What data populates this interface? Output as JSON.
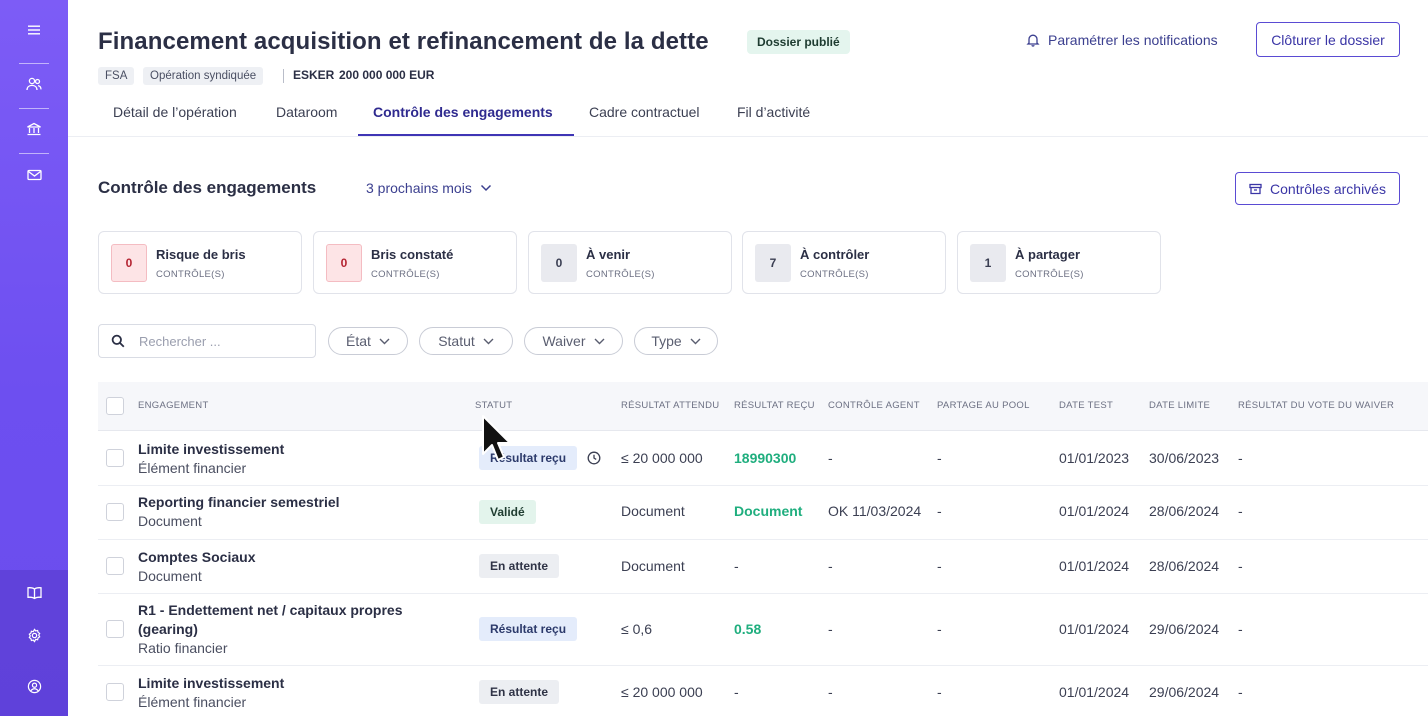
{
  "sidebar": {
    "icons": [
      "menu-icon",
      "users-icon",
      "bank-icon",
      "mail-icon",
      "book-icon",
      "settings-icon",
      "user-circle-icon"
    ]
  },
  "header": {
    "title": "Financement acquisition et refinancement de la dette",
    "status_badge": "Dossier publié",
    "tags": [
      "FSA",
      "Opération syndiquée"
    ],
    "company": "ESKER",
    "amount": "200 000 000 EUR",
    "notifications_label": "Paramétrer les notifications",
    "close_button": "Clôturer le dossier"
  },
  "tabs": [
    {
      "label": "Détail de l’opération"
    },
    {
      "label": "Dataroom"
    },
    {
      "label": "Contrôle des engagements",
      "active": true
    },
    {
      "label": "Cadre contractuel"
    },
    {
      "label": "Fil d’activité"
    }
  ],
  "section": {
    "title": "Contrôle des engagements",
    "period": "3 prochains mois",
    "archived_button": "Contrôles archivés"
  },
  "cards": [
    {
      "count": "0",
      "label": "Risque de bris",
      "sub": "CONTRÔLE(S)",
      "tone": "risk"
    },
    {
      "count": "0",
      "label": "Bris constaté",
      "sub": "CONTRÔLE(S)",
      "tone": "risk"
    },
    {
      "count": "0",
      "label": "À venir",
      "sub": "CONTRÔLE(S)",
      "tone": "neutral"
    },
    {
      "count": "7",
      "label": "À contrôler",
      "sub": "CONTRÔLE(S)",
      "tone": "neutral"
    },
    {
      "count": "1",
      "label": "À partager",
      "sub": "CONTRÔLE(S)",
      "tone": "neutral"
    }
  ],
  "filters": {
    "search_placeholder": "Rechercher ...",
    "search_value": "",
    "dropdowns": [
      "État",
      "Statut",
      "Waiver",
      "Type"
    ]
  },
  "table": {
    "columns": [
      "ENGAGEMENT",
      "STATUT",
      "RÉSULTAT ATTENDU",
      "RÉSULTAT REÇU",
      "CONTRÔLE AGENT",
      "PARTAGE AU POOL",
      "DATE TEST",
      "DATE LIMITE",
      "RÉSULTAT DU VOTE DU WAIVER"
    ],
    "rows": [
      {
        "title": "Limite investissement",
        "type": "Élément financier",
        "status": "Résultat reçu",
        "status_kind": "recu",
        "has_clock": true,
        "expected": "≤ 20 000 000",
        "received": "18990300",
        "received_green": true,
        "agent": "-",
        "pool": "-",
        "date_test": "01/01/2023",
        "date_limit": "30/06/2023",
        "waiver": "-"
      },
      {
        "title": "Reporting financier semestriel",
        "type": "Document",
        "status": "Validé",
        "status_kind": "valide",
        "has_clock": false,
        "expected": "Document",
        "received": "Document",
        "received_green": true,
        "agent": "OK 11/03/2024",
        "pool": "-",
        "date_test": "01/01/2024",
        "date_limit": "28/06/2024",
        "waiver": "-"
      },
      {
        "title": "Comptes Sociaux",
        "type": "Document",
        "status": "En attente",
        "status_kind": "attente",
        "has_clock": false,
        "expected": "Document",
        "received": "-",
        "received_green": false,
        "agent": "-",
        "pool": "-",
        "date_test": "01/01/2024",
        "date_limit": "28/06/2024",
        "waiver": "-"
      },
      {
        "title": "R1 - Endettement net / capitaux propres",
        "title2": "(gearing)",
        "type": "Ratio financier",
        "status": "Résultat reçu",
        "status_kind": "recu",
        "has_clock": false,
        "expected": "≤ 0,6",
        "received": "0.58",
        "received_green": true,
        "agent": "-",
        "pool": "-",
        "date_test": "01/01/2024",
        "date_limit": "29/06/2024",
        "waiver": "-"
      },
      {
        "title": "Limite investissement",
        "type": "Élément financier",
        "status": "En attente",
        "status_kind": "attente",
        "has_clock": false,
        "expected": "≤ 20 000 000",
        "received": "-",
        "received_green": false,
        "agent": "-",
        "pool": "-",
        "date_test": "01/01/2024",
        "date_limit": "29/06/2024",
        "waiver": "-"
      }
    ]
  },
  "colors": {
    "accent": "#6d4ff0",
    "link": "#3b3f8f",
    "green": "#1fae7e",
    "risk": "#b42331"
  }
}
